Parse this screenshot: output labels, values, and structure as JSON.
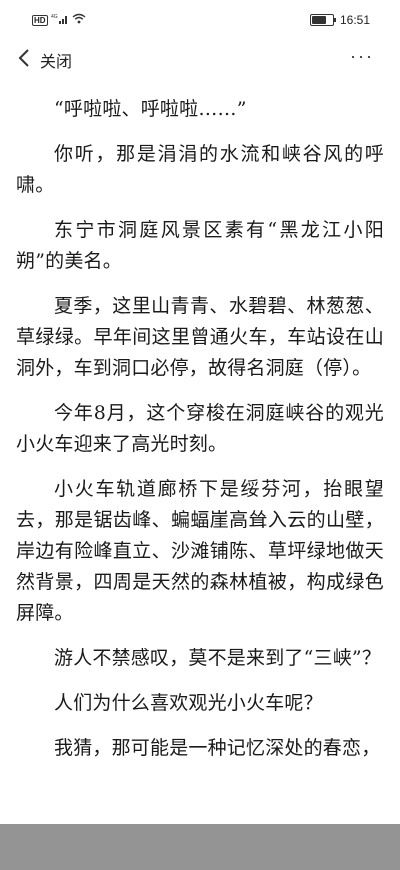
{
  "status_bar": {
    "network_badge": "HD",
    "signal": "4G",
    "time": "16:51",
    "battery_level": 0.8
  },
  "top_bar": {
    "back_label": "关闭",
    "more_label": "···"
  },
  "article": {
    "paragraphs": [
      "“呼啦啦、呼啦啦……”",
      "你听，那是涓涓的水流和峡谷风的呼啸。",
      "东宁市洞庭风景区素有“黑龙江小阳朔”的美名。",
      "夏季，这里山青青、水碧碧、林葱葱、草绿绿。早年间这里曾通火车，车站设在山洞外，车到洞口必停，故得名洞庭（停）。",
      "今年8月，这个穿梭在洞庭峡谷的观光小火车迎来了高光时刻。",
      "小火车轨道廊桥下是绥芬河，抬眼望去，那是锯齿峰、蝙蝠崖高耸入云的山壁，岸边有险峰直立、沙滩铺陈、草坪绿地做天然背景，四周是天然的森林植被，构成绿色屏障。",
      "游人不禁感叹，莫不是来到了“三峡”？",
      "人们为什么喜欢观光小火车呢？",
      "我猜，那可能是一种记忆深处的春恋，"
    ]
  },
  "colors": {
    "text": "#1a1a1a",
    "bottom_bar": "#8e8e8e"
  }
}
